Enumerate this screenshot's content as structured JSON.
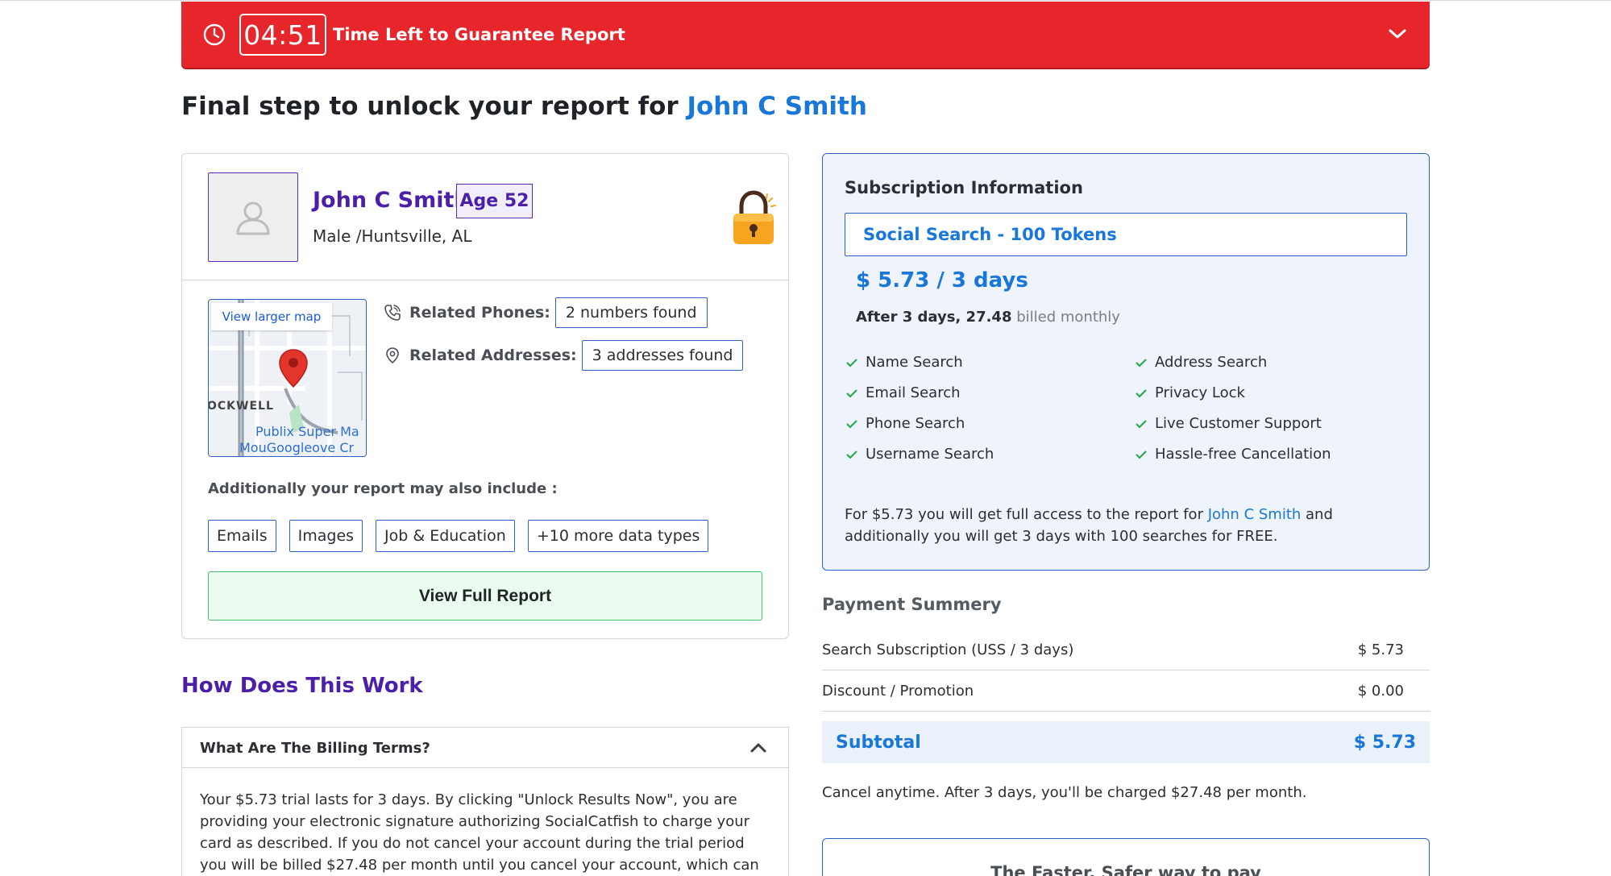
{
  "timer": {
    "time": "04:51",
    "label": "Time Left to Guarantee Report",
    "color": "#e7262b"
  },
  "page_title": {
    "prefix": "Final step to unlock your report for",
    "name": "John C Smith"
  },
  "profile": {
    "name": "John C Smith",
    "age": "Age 52",
    "details": "Male /Huntsville, AL",
    "map": {
      "link": "View larger map",
      "label_street": "OCKWELL",
      "label_store": "Publix Super Ma",
      "label_area": "MouGoogleove Cr"
    },
    "related_phones": {
      "label": "Related Phones:",
      "value": "2 numbers found"
    },
    "related_addresses": {
      "label": "Related Addresses:",
      "value": "3 addresses found"
    },
    "also_include": "Additionally your report may also include :",
    "chips": [
      "Emails",
      "Images",
      "Job & Education",
      "+10 more data types"
    ],
    "view_button": "View Full Report"
  },
  "how": {
    "title": "How Does This Work",
    "question": "What Are The Billing Terms?",
    "answer": "Your $5.73 trial lasts for 3 days. By clicking \"Unlock Results Now\", you are providing your electronic signature authorizing SocialCatfish to charge your card as described. If you do not cancel your account during the trial period you will be billed $27.48 per month until you cancel your account, which can be"
  },
  "subscription": {
    "title": "Subscription Information",
    "plan": "Social Search - 100 Tokens",
    "price": "$ 5.73 / 3 days",
    "after_bold": "After 3 days, 27.48",
    "after_muted": "billed monthly",
    "features_left": [
      "Name Search",
      "Email Search",
      "Phone Search",
      "Username Search"
    ],
    "features_right": [
      "Address Search",
      "Privacy Lock",
      "Live Customer Support",
      "Hassle-free Cancellation"
    ],
    "note_prefix": "For $5.73 you will get full access to the report for",
    "note_name": "John C Smith",
    "note_suffix": "and additionally you will get 3 days with 100 searches for FREE."
  },
  "payment": {
    "title": "Payment Summery",
    "rows": [
      {
        "label": "Search Subscription (USS / 3 days)",
        "value": "$ 5.73"
      },
      {
        "label": "Discount / Promotion",
        "value": "$ 0.00"
      }
    ],
    "subtotal_label": "Subtotal",
    "subtotal_value": "$ 5.73",
    "cancel_note": "Cancel anytime. After 3 days, you'll be charged $27.48 per month.",
    "faster": "The Faster, Safer way to pay"
  }
}
